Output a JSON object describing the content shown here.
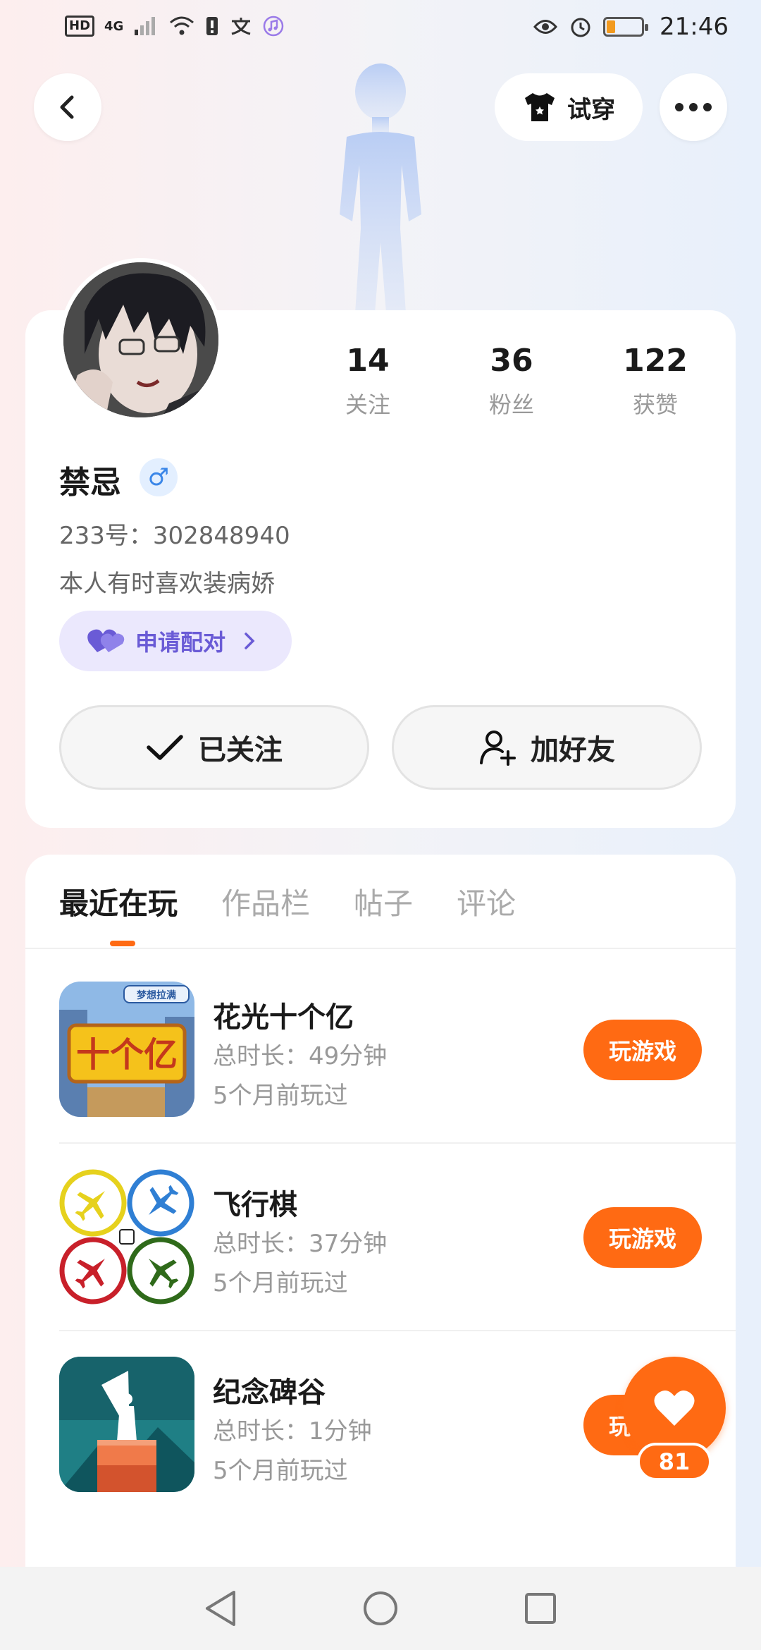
{
  "status_bar": {
    "hd": "HD",
    "network": "4G",
    "time": "21:46"
  },
  "header": {
    "try_on_label": "试穿"
  },
  "profile": {
    "stats": [
      {
        "num": "14",
        "label": "关注"
      },
      {
        "num": "36",
        "label": "粉丝"
      },
      {
        "num": "122",
        "label": "获赞"
      }
    ],
    "name": "禁忌",
    "gender_symbol": "♂",
    "uid": "233号：302848940",
    "bio": "本人有时喜欢装病娇",
    "pair_label": "申请配对",
    "follow_label": "已关注",
    "add_friend_label": "加好友"
  },
  "tabs": [
    {
      "label": "最近在玩",
      "active": true
    },
    {
      "label": "作品栏",
      "active": false
    },
    {
      "label": "帖子",
      "active": false
    },
    {
      "label": "评论",
      "active": false
    }
  ],
  "games": [
    {
      "title": "花光十个亿",
      "duration": "总时长：49分钟",
      "last_played": "5个月前玩过",
      "play_label": "玩游戏",
      "icon_text": "十个亿",
      "banner": "梦想拉满"
    },
    {
      "title": "飞行棋",
      "duration": "总时长：37分钟",
      "last_played": "5个月前玩过",
      "play_label": "玩游戏"
    },
    {
      "title": "纪念碑谷",
      "duration": "总时长：1分钟",
      "last_played": "5个月前玩过",
      "play_label": "玩游戏"
    }
  ],
  "like_count": "81",
  "colors": {
    "accent": "#ff6a13",
    "pair": "#6a5bd6",
    "gender": "#3a86e8"
  }
}
